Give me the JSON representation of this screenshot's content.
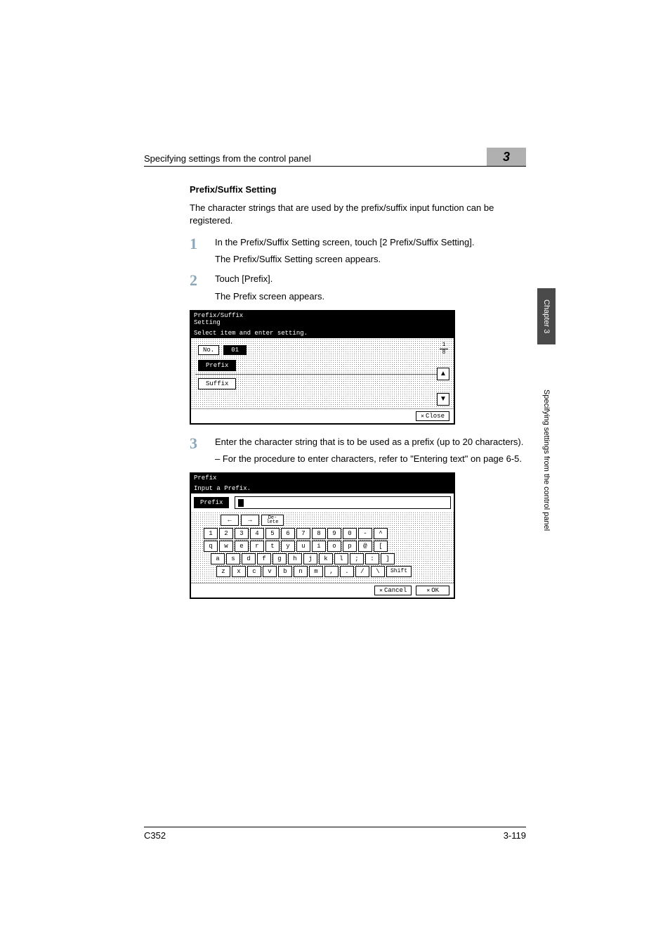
{
  "header": {
    "title": "Specifying settings from the control panel",
    "chapter_num": "3"
  },
  "section": {
    "title": "Prefix/Suffix Setting",
    "intro": "The character strings that are used by the prefix/suffix input function can be registered."
  },
  "steps": {
    "s1": {
      "num": "1",
      "text": "In the Prefix/Suffix Setting screen, touch [2 Prefix/Suffix Setting].",
      "sub": "The Prefix/Suffix Setting screen appears."
    },
    "s2": {
      "num": "2",
      "text": "Touch [Prefix].",
      "sub": "The Prefix screen appears."
    },
    "s3": {
      "num": "3",
      "text": "Enter the character string that is to be used as a prefix (up to 20 characters).",
      "note": "–   For the procedure to enter characters, refer to \"Entering text\" on page 6-5."
    }
  },
  "screenshot1": {
    "title1": "Prefix/Suffix",
    "title2": "Setting",
    "instruction": "Select item and enter setting.",
    "no_label": "No.",
    "no_value": "01",
    "prefix_label": "Prefix",
    "suffix_label": "Suffix",
    "page_top": "1",
    "page_bottom": "8",
    "close": "Close"
  },
  "screenshot2": {
    "title": "Prefix",
    "instruction": "Input a Prefix.",
    "input_label": "Prefix",
    "arrow_left": "←",
    "arrow_right": "→",
    "delete": "De-\nlete",
    "row1": [
      "1",
      "2",
      "3",
      "4",
      "5",
      "6",
      "7",
      "8",
      "9",
      "0",
      "-",
      "^"
    ],
    "row2": [
      "q",
      "w",
      "e",
      "r",
      "t",
      "y",
      "u",
      "i",
      "o",
      "p",
      "@",
      "["
    ],
    "row3": [
      "a",
      "s",
      "d",
      "f",
      "g",
      "h",
      "j",
      "k",
      "l",
      ";",
      ":",
      "]"
    ],
    "row4": [
      "z",
      "x",
      "c",
      "v",
      "b",
      "n",
      "m",
      ",",
      ".",
      "/",
      "\\"
    ],
    "shift": "Shift",
    "cancel": "Cancel",
    "ok": "OK"
  },
  "side": {
    "chapter": "Chapter 3",
    "title": "Specifying settings from the control panel"
  },
  "footer": {
    "model": "C352",
    "page": "3-119"
  }
}
